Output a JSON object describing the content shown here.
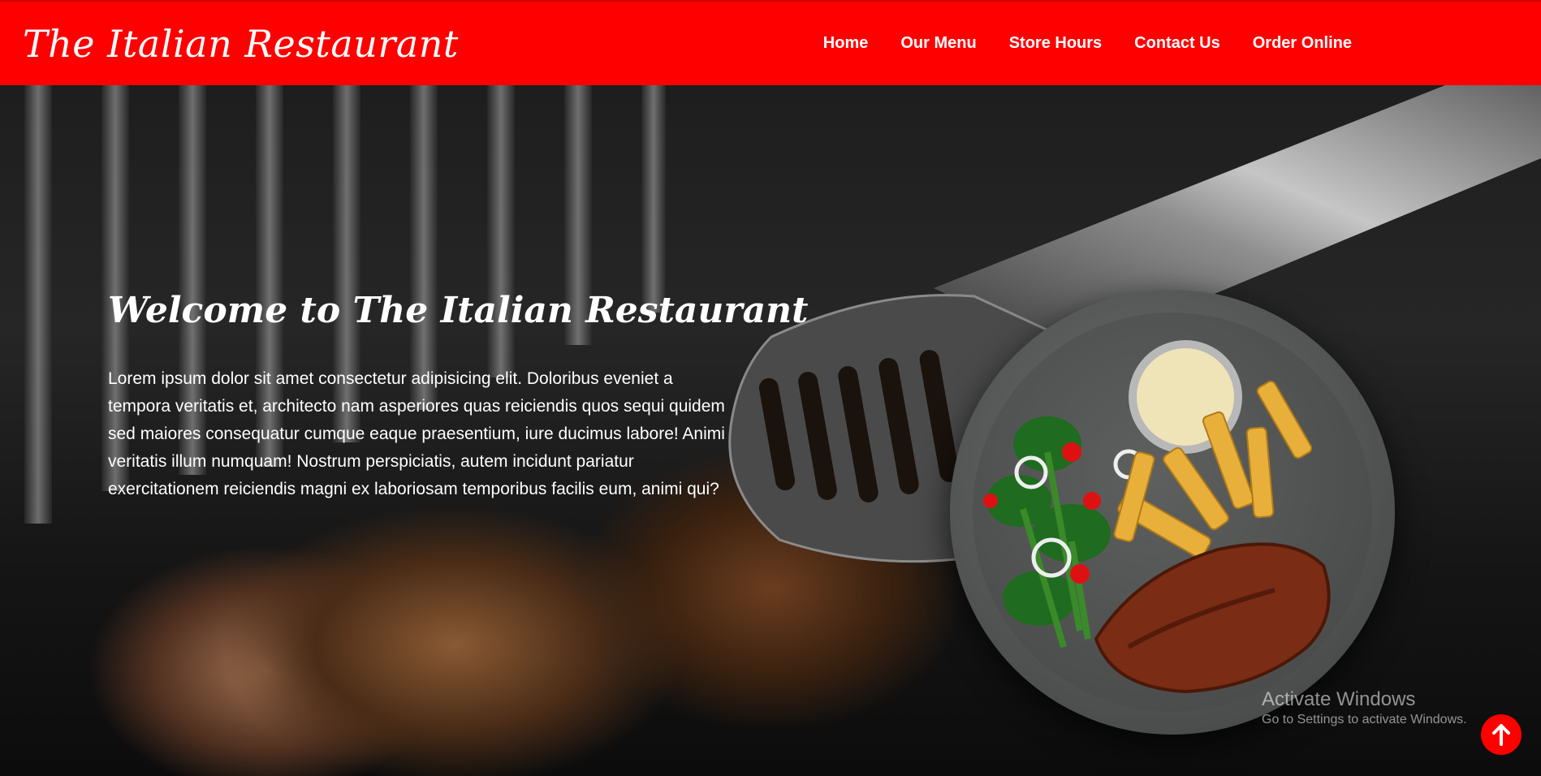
{
  "navbar": {
    "brand": "The Italian Restaurant",
    "links": [
      {
        "label": "Home"
      },
      {
        "label": "Our Menu"
      },
      {
        "label": "Store Hours"
      },
      {
        "label": "Contact Us"
      },
      {
        "label": "Order Online"
      }
    ],
    "background_color": "#ff0000"
  },
  "hero": {
    "title": "Welcome to The Italian Restaurant",
    "body": "Lorem ipsum dolor sit amet consectetur adipisicing elit. Doloribus eveniet a tempora veritatis et, architecto nam asperiores quas reiciendis quos sequi quidem sed maiores consequatur cumque eaque praesentium, iure ducimus labore! Animi veritatis illum numquam! Nostrum perspiciatis, autem incidunt pariatur exercitationem reiciendis magni ex laboriosam temporibus facilis eum, animi qui?"
  },
  "os_watermark": {
    "title": "Activate Windows",
    "subtitle": "Go to Settings to activate Windows."
  },
  "scroll_top_button": {
    "icon": "arrow-up-icon",
    "color": "#ff0000"
  }
}
